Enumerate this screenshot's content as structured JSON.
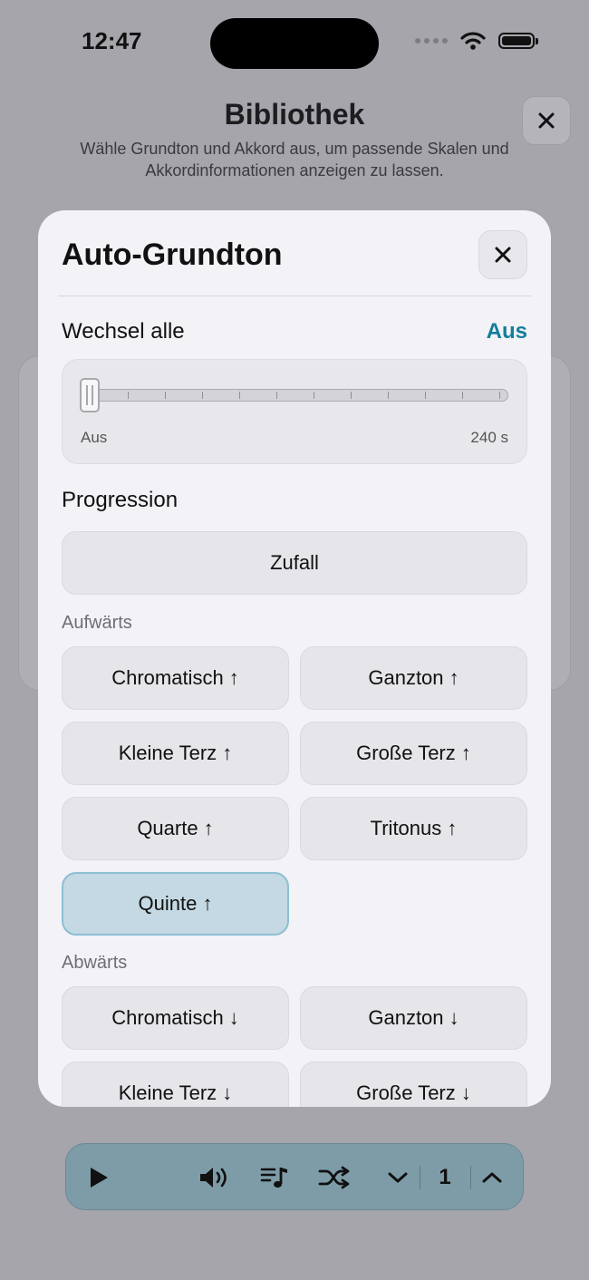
{
  "status": {
    "time": "12:47"
  },
  "background": {
    "title": "Bibliothek",
    "subtitle": "Wähle Grundton und Akkord aus, um passende Skalen und Akkordinformationen anzeigen zu lassen."
  },
  "sheet": {
    "title": "Auto-Grundton",
    "interval": {
      "label": "Wechsel alle",
      "value": "Aus",
      "slider_min_label": "Aus",
      "slider_max_label": "240 s",
      "slider_fraction": 0
    },
    "progression_label": "Progression",
    "random_label": "Zufall",
    "upward_label": "Aufwärts",
    "upward": [
      "Chromatisch ↑",
      "Ganzton ↑",
      "Kleine Terz ↑",
      "Große Terz ↑",
      "Quarte ↑",
      "Tritonus ↑",
      "Quinte ↑"
    ],
    "selected": "Quinte ↑",
    "downward_label": "Abwärts",
    "downward": [
      "Chromatisch ↓",
      "Ganzton ↓",
      "Kleine Terz ↓",
      "Große Terz ↓"
    ]
  },
  "toolbar": {
    "icons": [
      "play-icon",
      "speaker-icon",
      "playlist-icon",
      "shuffle-icon",
      "chevron-down-icon",
      "chevron-up-icon"
    ],
    "count": "1"
  },
  "colors": {
    "accent": "#137e9b",
    "selected_fill": "#c4d9e3",
    "toolbar": "#7d9ca8"
  }
}
